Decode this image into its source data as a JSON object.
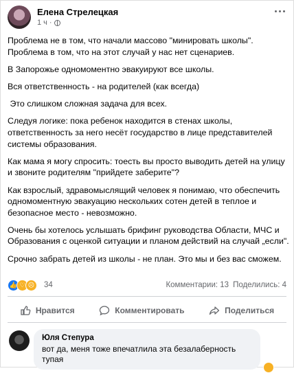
{
  "header": {
    "author": "Елена Стрелецкая",
    "time": "1 ч",
    "separator": "·"
  },
  "paragraphs": [
    "Проблема не в том, что начали массово \"минировать школы\". Проблема в том, что на этот случай у нас нет сценариев.",
    "В Запорожье одномоментно эвакуируют все школы.",
    "Вся ответственность - на родителей (как всегда)",
    " Это слишком сложная задача для всех.",
    "Следуя логике: пока ребенок находится в стенах школы, ответственность за него несёт государство в лице представителей системы образования.",
    "Как мама я могу спросить: тоесть вы просто выводить детей на улицу и звоните родителям \"прийдете заберите\"?",
    "Как взрослый, здравомыслящий человек я понимаю, что обеспечить одномоментную эвакуацию нескольких сотен детей в теплое и безопасное место - невозможно.",
    "Очень бы хотелось услышать брифинг руководства Области, МЧС и Образования с оценкой ситуации и планом действий на случай „если\".",
    "Срочно забрать детей из школы - не план. Это мы и без вас сможем."
  ],
  "reactions": {
    "count": "34",
    "comments": "Комментарии: 13",
    "shares": "Поделились: 4"
  },
  "actions": {
    "like": "Нравится",
    "comment": "Комментировать",
    "share": "Поделиться"
  },
  "comment": {
    "author": "Юля Степура",
    "text": "вот да, меня тоже впечатлила эта безалаберность тупая"
  },
  "colors": {
    "accent": "#1877f2",
    "secondary_text": "#65676b",
    "bubble": "#f0f2f5"
  }
}
